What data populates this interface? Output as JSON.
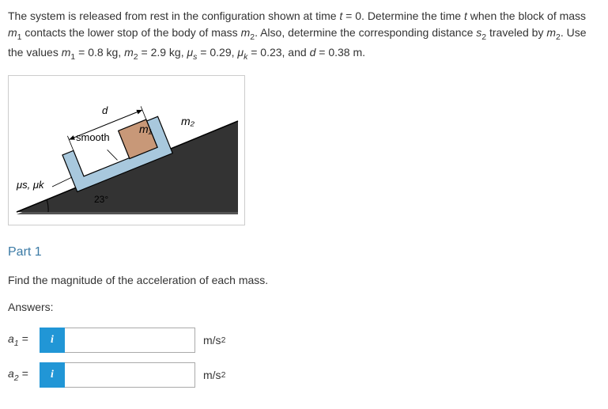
{
  "problem": {
    "text_html": "The system is released from rest in the configuration shown at time <em>t</em> = 0. Determine the time <em>t</em> when the block of mass <em>m</em><span class='sub'>1</span> contacts the lower stop of the body of mass <em>m</em><span class='sub'>2</span>. Also, determine the corresponding distance <em>s</em><span class='sub'>2</span> traveled by <em>m</em><span class='sub'>2</span>. Use the values <em>m</em><span class='sub'>1</span> = 0.8 kg, <em>m</em><span class='sub'>2</span> = 2.9 kg, <em>μ<span class='sub'>s</span></em> = 0.29, <em>μ<span class='sub'>k</span></em> = 0.23, and <em>d</em> = 0.38 m."
  },
  "diagram": {
    "d_label": "d",
    "smooth_label": "smooth",
    "m1_label": "m₁",
    "m2_label": "m₂",
    "friction_label": "μs, μk",
    "angle_label": "23°"
  },
  "part1": {
    "header": "Part 1",
    "instruction": "Find the magnitude of the acceleration of each mass.",
    "answers_label": "Answers:",
    "rows": [
      {
        "label_html": "<em>a</em><span class='sub'>1</span> =",
        "value": "",
        "unit_html": "m/s<span class='sup'>2</span>"
      },
      {
        "label_html": "<em>a</em><span class='sub'>2</span> =",
        "value": "",
        "unit_html": "m/s<span class='sup'>2</span>"
      }
    ],
    "info_icon": "i"
  }
}
